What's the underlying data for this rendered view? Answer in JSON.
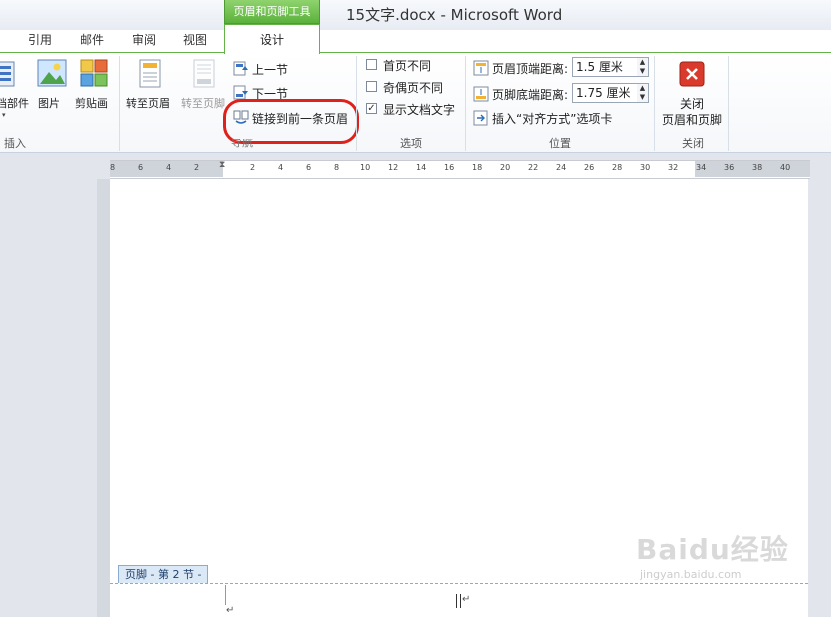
{
  "window": {
    "title": "15文字.docx - Microsoft Word",
    "context_group": "页眉和页脚工具"
  },
  "tabs": [
    {
      "label": "引用"
    },
    {
      "label": "邮件"
    },
    {
      "label": "审阅"
    },
    {
      "label": "视图"
    },
    {
      "label": "设计"
    }
  ],
  "ribbon": {
    "insert_group": {
      "label": "插入",
      "parts_label": "档部件",
      "picture_label": "图片",
      "clipart_label": "剪贴画"
    },
    "navigation_group": {
      "label": "导航",
      "goto_header_label": "转至页眉",
      "goto_footer_label": "转至页脚",
      "prev_section_label": "上一节",
      "next_section_label": "下一节",
      "link_previous_label": "链接到前一条页眉"
    },
    "options_group": {
      "label": "选项",
      "first_page_label": "首页不同",
      "first_page_checked": false,
      "odd_even_label": "奇偶页不同",
      "odd_even_checked": false,
      "show_text_label": "显示文档文字",
      "show_text_checked": true
    },
    "position_group": {
      "label": "位置",
      "header_top_label": "页眉顶端距离:",
      "header_top_value": "1.5 厘米",
      "footer_bottom_label": "页脚底端距离:",
      "footer_bottom_value": "1.75 厘米",
      "insert_align_tab_label": "插入“对齐方式”选项卡"
    },
    "close_group": {
      "label": "关闭",
      "close_line1": "关闭",
      "close_line2": "页眉和页脚"
    }
  },
  "ruler": {
    "ticks": [
      "8",
      "6",
      "4",
      "2",
      "2",
      "4",
      "6",
      "8",
      "10",
      "12",
      "14",
      "16",
      "18",
      "20",
      "22",
      "24",
      "26",
      "28",
      "30",
      "32",
      "34",
      "36",
      "38",
      "40"
    ]
  },
  "document": {
    "footer_tag": "页脚 - 第 2 节 -"
  },
  "watermark": {
    "brand": "Baidu经验",
    "url": "jingyan.baidu.com"
  },
  "colors": {
    "context_green": "#5bb13c",
    "highlight_red": "#e0201b",
    "close_red": "#d93a2b"
  }
}
